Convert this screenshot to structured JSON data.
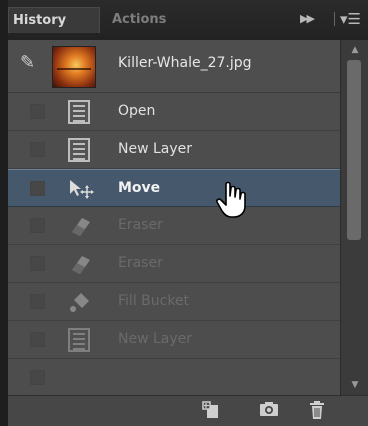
{
  "panel": {
    "tabs": [
      {
        "label": "History",
        "active": true
      },
      {
        "label": "Actions",
        "active": false
      }
    ],
    "expand_icon": "double-chevron-right-icon",
    "menu_icon": "panel-menu-icon"
  },
  "snapshot": {
    "name": "Killer-Whale_27.jpg",
    "source_icon": "history-brush-icon"
  },
  "states": [
    {
      "label": "Open",
      "icon": "document-icon",
      "selected": false,
      "dimmed": false
    },
    {
      "label": "New Layer",
      "icon": "document-icon",
      "selected": false,
      "dimmed": false
    },
    {
      "label": "Move",
      "icon": "move-tool-icon",
      "selected": true,
      "dimmed": false
    },
    {
      "label": "Eraser",
      "icon": "eraser-icon",
      "selected": false,
      "dimmed": true
    },
    {
      "label": "Eraser",
      "icon": "eraser-icon",
      "selected": false,
      "dimmed": true
    },
    {
      "label": "Fill Bucket",
      "icon": "paint-bucket-icon",
      "selected": false,
      "dimmed": true
    },
    {
      "label": "New Layer",
      "icon": "document-icon",
      "selected": false,
      "dimmed": true
    }
  ],
  "bottom_buttons": [
    "new-document-from-state-icon",
    "camera-icon",
    "trash-icon"
  ],
  "colors": {
    "panel_bg": "#535353",
    "selected_row": "#46596c",
    "text": "#e2e2e2",
    "dim_text": "#6a6a6a"
  }
}
